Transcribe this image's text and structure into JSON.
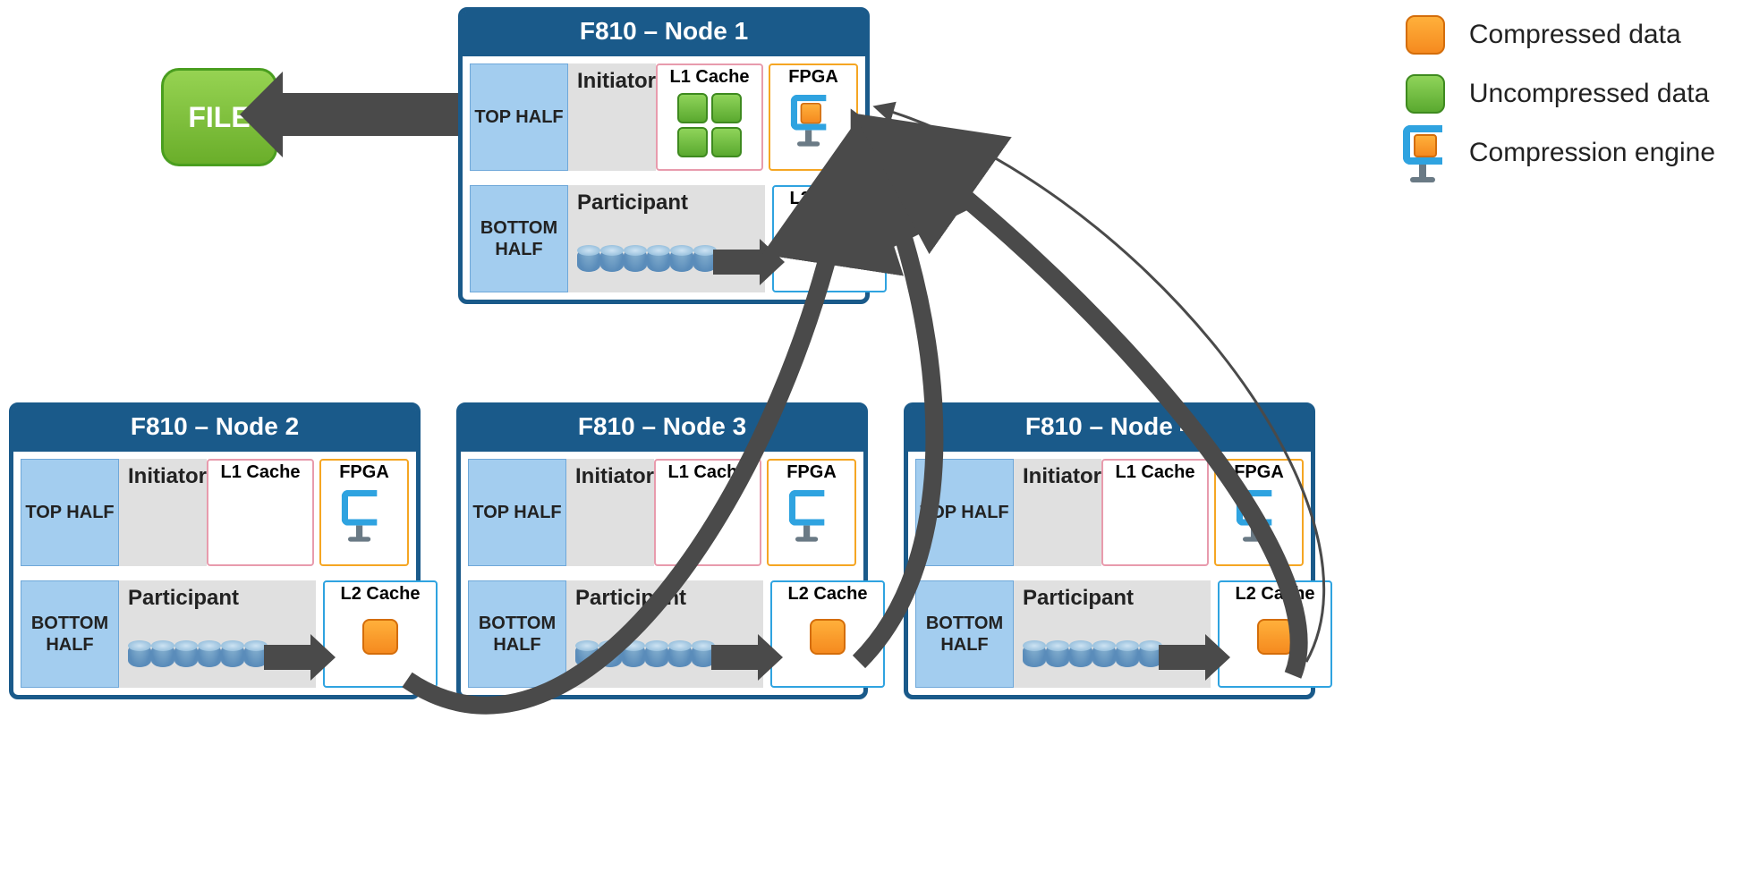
{
  "legend": {
    "compressed": "Compressed data",
    "uncompressed": "Uncompressed data",
    "engine": "Compression engine"
  },
  "file_label": "FILE",
  "labels": {
    "top_half": "TOP HALF",
    "bottom_half": "BOTTOM HALF",
    "initiator": "Initiator",
    "participant": "Participant",
    "l1": "L1 Cache",
    "l2": "L2 Cache",
    "fpga": "FPGA"
  },
  "nodes": {
    "n1": {
      "title": "F810 – Node 1"
    },
    "n2": {
      "title": "F810 – Node 2"
    },
    "n3": {
      "title": "F810 – Node 3"
    },
    "n4": {
      "title": "F810 – Node 4"
    }
  },
  "colors": {
    "header": "#1a5a8a",
    "half_bg": "#a3cdef",
    "orange": "#f58a1f",
    "green": "#6aae2a",
    "arrow": "#4a4a4a"
  }
}
